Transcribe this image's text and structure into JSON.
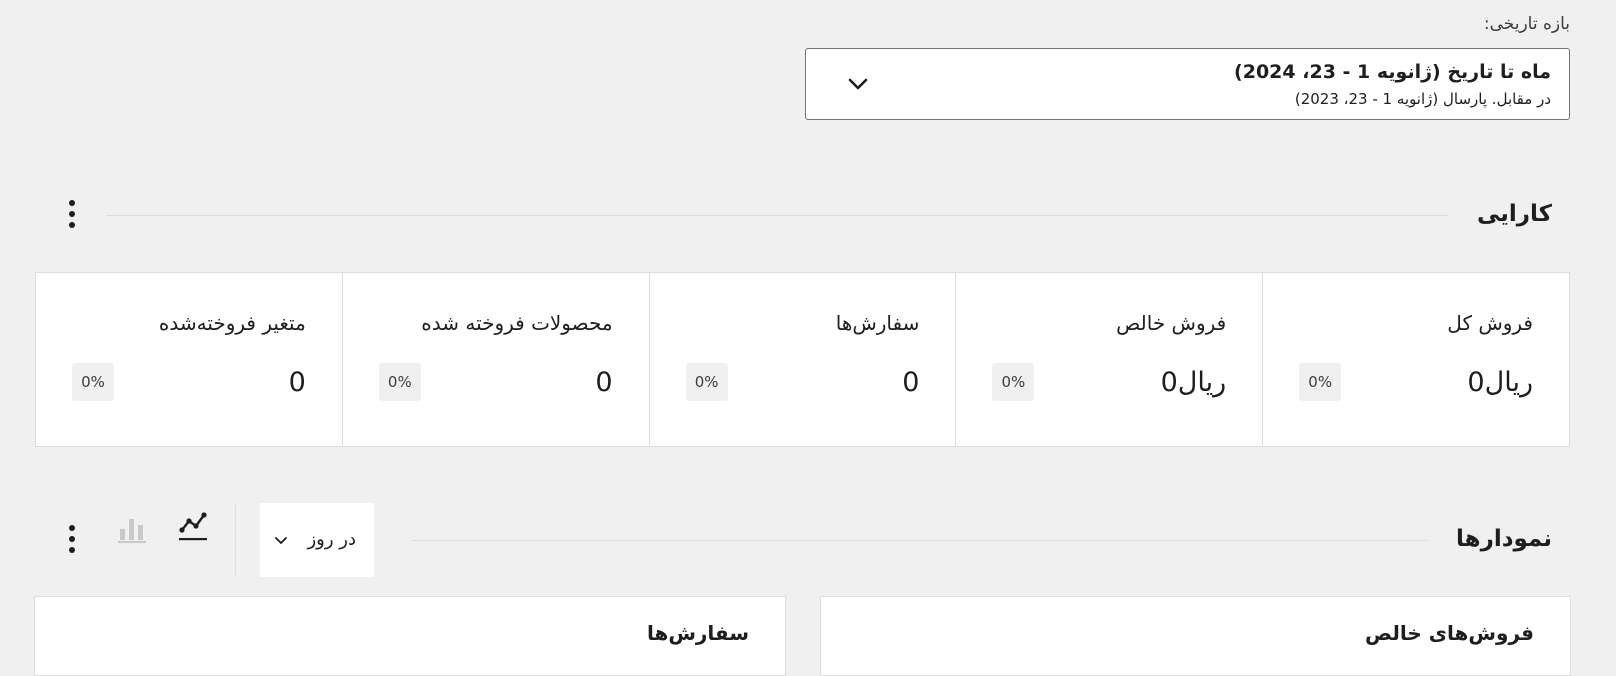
{
  "date_range": {
    "label": "بازه تاریخی:",
    "primary": "ماه تا تاریخ (ژانویه 1 - 23، 2024)",
    "secondary": "در مقابل. پارسال (ژانویه 1 - 23، 2023)"
  },
  "performance": {
    "title": "کارایی",
    "cards": [
      {
        "label": "فروش کل",
        "value": "ریال0",
        "delta": "0%"
      },
      {
        "label": "فروش خالص",
        "value": "ریال0",
        "delta": "0%"
      },
      {
        "label": "سفارش‌ها",
        "value": "0",
        "delta": "0%"
      },
      {
        "label": "محصولات فروخته شده",
        "value": "0",
        "delta": "0%"
      },
      {
        "label": "متغیر فروخته‌شده",
        "value": "0",
        "delta": "0%"
      }
    ]
  },
  "charts": {
    "title": "نمودارها",
    "interval": "در روز",
    "chart_type_options": [
      "line-chart-icon",
      "bar-chart-icon"
    ],
    "selected_chart_type": "line",
    "panels": [
      {
        "title": "فروش‌های خالص"
      },
      {
        "title": "سفارش‌ها"
      }
    ]
  },
  "colors": {
    "background": "#f0f0f0",
    "card_background": "#ffffff",
    "border": "#dcdcdc",
    "text": "#1e1e1e",
    "icon_active": "#1e1e1e",
    "icon_inactive": "#c8c8c8"
  }
}
